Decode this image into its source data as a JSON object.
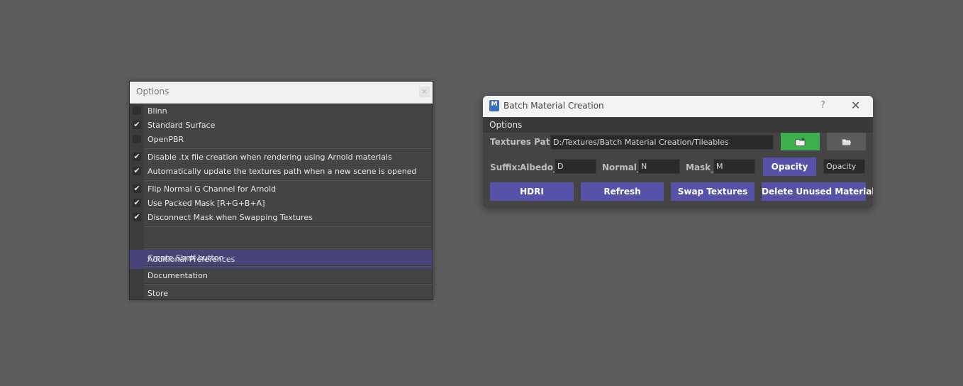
{
  "options_window": {
    "title": "Options",
    "close_glyph": "×",
    "items": [
      {
        "label": "Blinn",
        "checked": false
      },
      {
        "label": "Standard Surface",
        "checked": true
      },
      {
        "label": "OpenPBR",
        "checked": false
      },
      {
        "label": "Disable .tx file creation when rendering using Arnold materials",
        "checked": true
      },
      {
        "label": "Automatically update the textures path when a new scene is opened",
        "checked": true
      },
      {
        "label": "Flip Normal G Channel for Arnold",
        "checked": true
      },
      {
        "label": "Use Packed Mask [R+G+B+A]",
        "checked": true
      },
      {
        "label": "Disconnect Mask when Swapping Textures",
        "checked": true
      }
    ],
    "highlighted_item": "Additional Preferences",
    "menu_items": [
      "Create Shelf button",
      "Documentation",
      "Store"
    ]
  },
  "batch_window": {
    "logo_text": "M",
    "title": "Batch Material Creation",
    "help_glyph": "?",
    "close_glyph": "✕",
    "menu": {
      "options": "Options"
    },
    "textures_path_label": "Textures Path:",
    "textures_path_value": "D:/Textures/Batch Material Creation/Tileables",
    "suffix_label": "Suffix:",
    "albedo_label": "Albedo_",
    "albedo_value": "D",
    "normal_label": "Normal_",
    "normal_value": "N",
    "mask_label": "Mask_",
    "mask_value": "M",
    "opacity_button": "Opacity",
    "opacity_value": "Opacity",
    "buttons": {
      "hdri": "HDRI",
      "refresh": "Refresh",
      "swap_textures": "Swap Textures",
      "delete_unused": "Delete Unused Materials"
    },
    "colors": {
      "accent": "#5652a8",
      "create_folder": "#3fae4f"
    }
  }
}
